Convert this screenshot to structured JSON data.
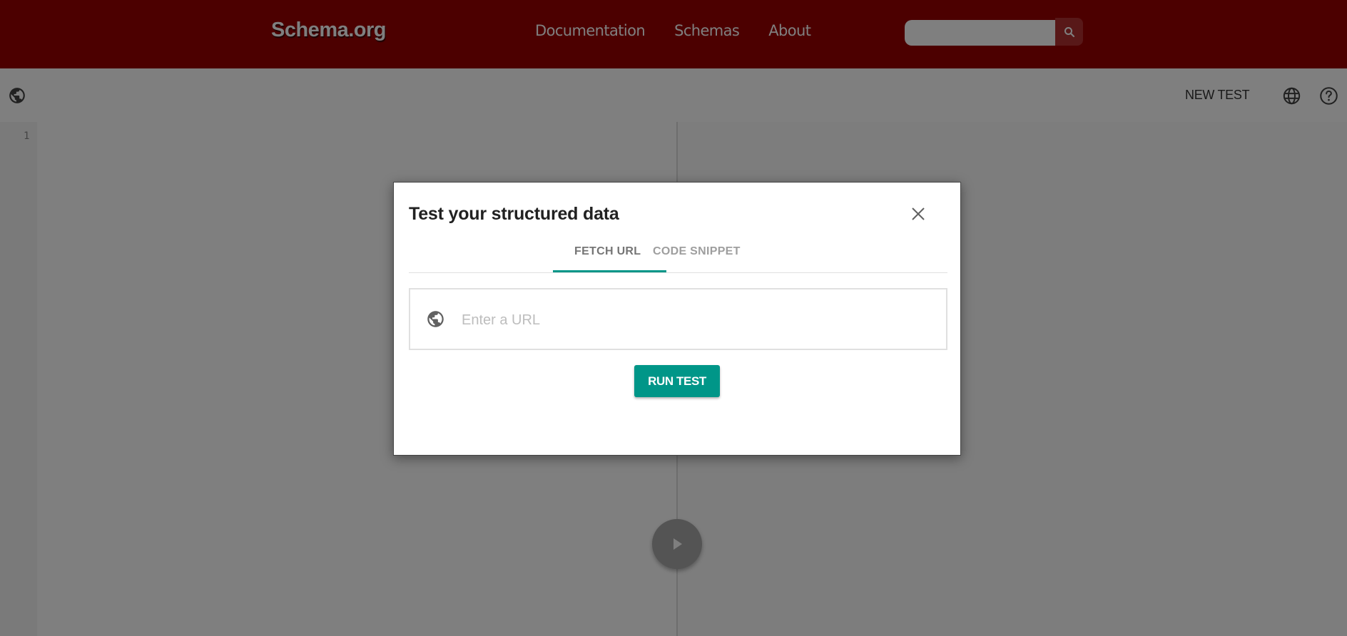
{
  "header": {
    "logo": "Schema.org",
    "nav": [
      {
        "label": "Documentation"
      },
      {
        "label": "Schemas"
      },
      {
        "label": "About"
      }
    ],
    "search": {
      "placeholder": "",
      "icon": "search-icon"
    },
    "colors": {
      "brand": "#990000"
    }
  },
  "toolbar": {
    "left_icon": "globe-icon",
    "new_test_label": "NEW TEST",
    "language_icon": "language-icon",
    "help_icon": "help-icon"
  },
  "editor": {
    "line_numbers": [
      "1"
    ],
    "run_icon": "play-icon"
  },
  "dialog": {
    "title": "Test your structured data",
    "close_icon": "close-icon",
    "tabs": [
      {
        "label": "FETCH URL",
        "active": true
      },
      {
        "label": "CODE SNIPPET",
        "active": false
      }
    ],
    "url_field": {
      "placeholder": "Enter a URL",
      "value": "",
      "icon": "globe-icon"
    },
    "run_button_label": "RUN TEST",
    "colors": {
      "accent": "#009688"
    }
  }
}
